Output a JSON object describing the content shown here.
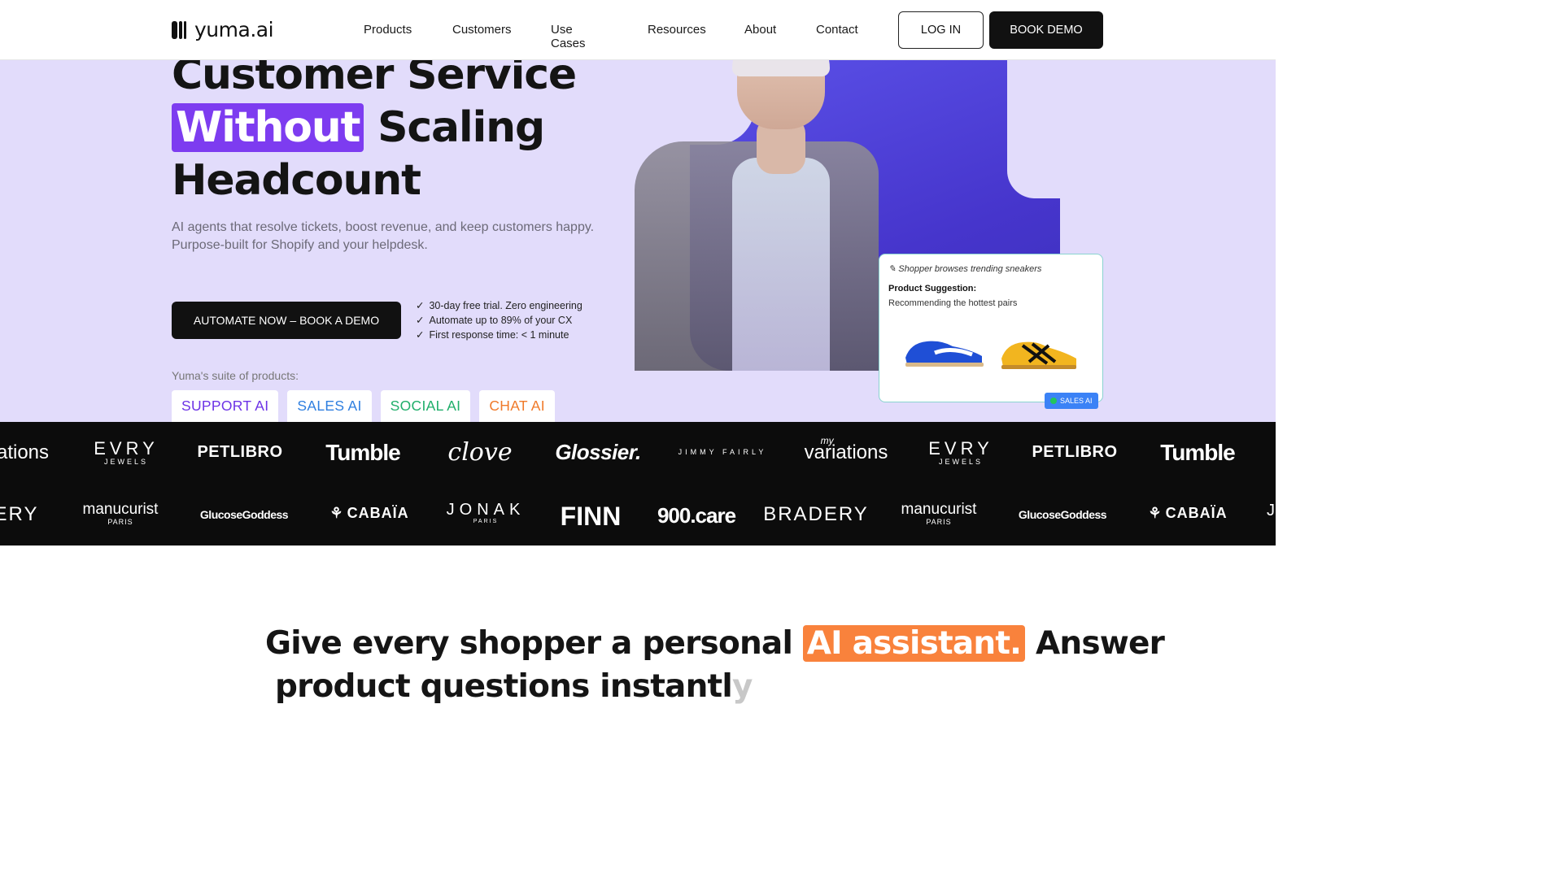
{
  "header": {
    "brand": "yuma.ai",
    "nav": [
      "Products",
      "Customers",
      "Use Cases",
      "Resources",
      "About",
      "Contact"
    ],
    "login_label": "LOG IN",
    "demo_label": "BOOK DEMO"
  },
  "hero": {
    "headline_line1": "Customer Service",
    "headline_highlight": "Without",
    "headline_line2_rest": " Scaling",
    "headline_line3": "Headcount",
    "sub_line1": "AI agents that resolve tickets, boost revenue, and keep customers happy.",
    "sub_line2": "Purpose-built for Shopify and your helpdesk.",
    "cta_label": "AUTOMATE NOW – BOOK A DEMO",
    "checks": [
      "30-day free trial. Zero engineering",
      "Automate up to 89% of your CX",
      "First response time: < 1 minute"
    ],
    "suite_label": "Yuma's suite of products:",
    "products": [
      {
        "label": "SUPPORT AI",
        "color": "#6d33e6"
      },
      {
        "label": "SALES AI",
        "color": "#2f7fe0"
      },
      {
        "label": "SOCIAL AI",
        "color": "#1fae6a"
      },
      {
        "label": "CHAT AI",
        "color": "#f07a2a"
      }
    ],
    "card": {
      "top": "Shopper browses trending sneakers",
      "title": "Product Suggestion:",
      "subtitle": "Recommending the hottest pairs",
      "badge": "SALES AI"
    }
  },
  "logos_row1": [
    "ations",
    "EVRY",
    "JEWELS",
    "PETLIBRO",
    "Tumble",
    "clove",
    "Glossier.",
    "JIMMY FAIRLY",
    "variations",
    "my",
    "EVRY",
    "JEWELS",
    "PETLIBRO",
    "Tumble"
  ],
  "logos_row2": [
    "ERY",
    "manucurist",
    "PARIS",
    "GlucoseGoddess",
    "CABAÏA",
    "JONAK",
    "PARIS",
    "FINN",
    "900.care",
    "BRADERY",
    "manucurist",
    "PARIS",
    "GlucoseGoddess",
    "CABAÏA",
    "J"
  ],
  "section": {
    "line1_a": "Give every shopper a personal ",
    "line1_highlight": "AI assistant.",
    "line1_b": " Answer",
    "line2_a": "product questions instantl",
    "line2_fade": "y"
  },
  "colors": {
    "hero_bg": "#e2dcfb",
    "accent_purple": "#7d3cf0",
    "accent_orange": "#f9823c",
    "dark": "#111111"
  }
}
